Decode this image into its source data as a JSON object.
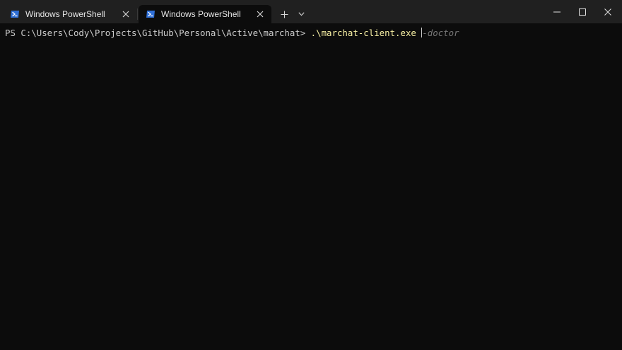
{
  "tabs": [
    {
      "label": "Windows PowerShell",
      "icon": "powershell-icon",
      "active": false
    },
    {
      "label": "Windows PowerShell",
      "icon": "powershell-icon",
      "active": true
    }
  ],
  "terminal": {
    "prompt": "PS C:\\Users\\Cody\\Projects\\GitHub\\Personal\\Active\\marchat> ",
    "command": ".\\marchat-client.exe ",
    "suggestion": "-doctor"
  },
  "colors": {
    "titlebar_bg": "#202020",
    "terminal_bg": "#0c0c0c",
    "prompt_text": "#cccccc",
    "command_text": "#f9f1a5",
    "suggestion_text": "#767676",
    "icon_blue": "#2f6fd6"
  }
}
